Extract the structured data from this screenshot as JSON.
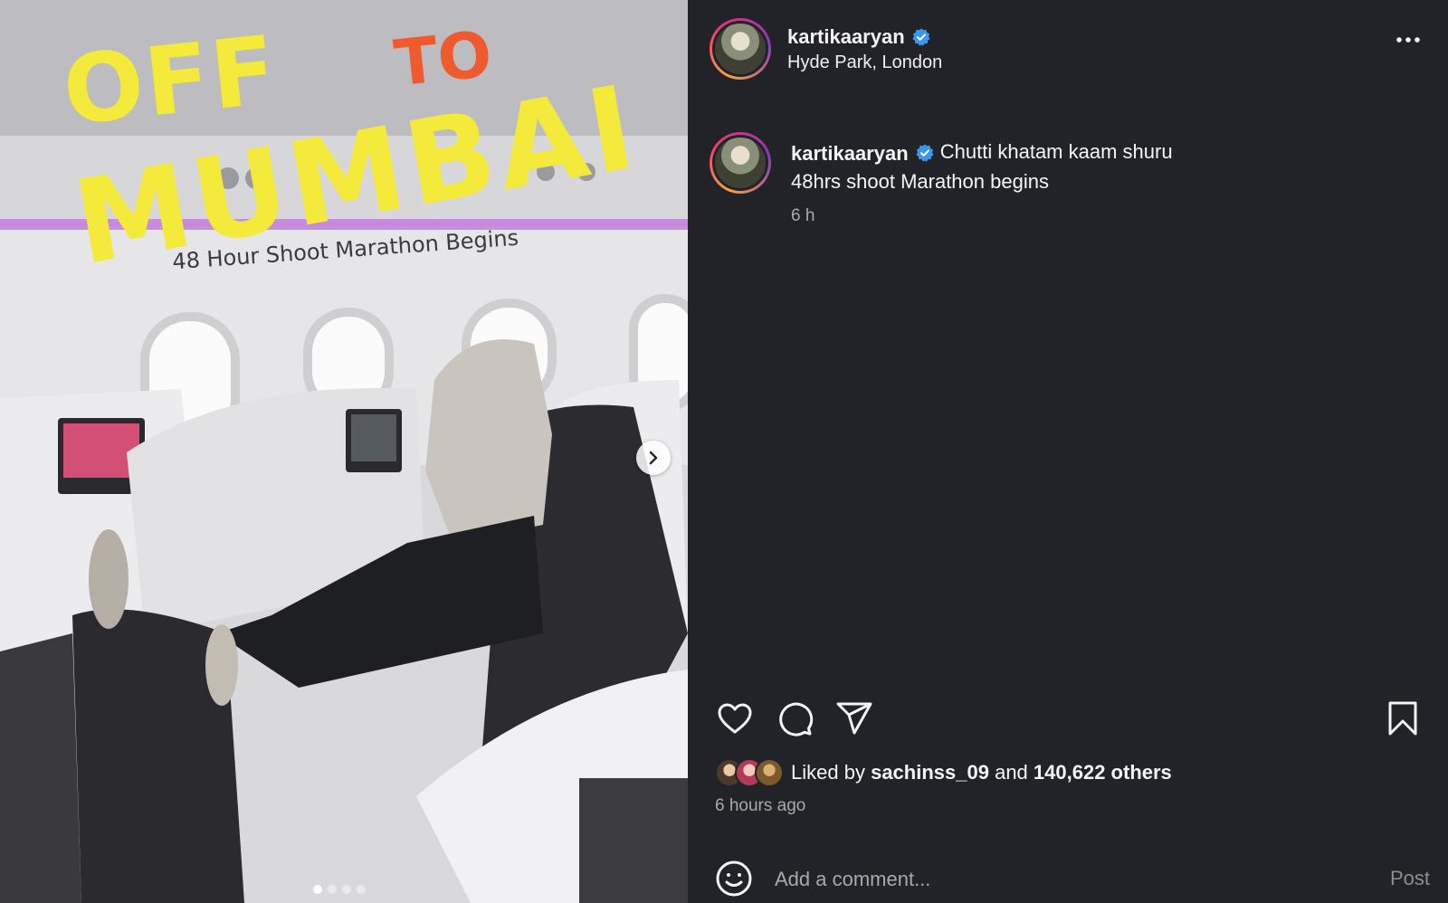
{
  "media": {
    "overlay_line1": "OFF",
    "overlay_line2": "TO",
    "overlay_line3": "MUMBAI",
    "overlay_subtitle": "48 Hour Shoot Marathon Begins",
    "slide_count": 4,
    "active_slide": 1,
    "next_icon": "chevron-right-icon"
  },
  "post": {
    "username": "kartikaaryan",
    "location": "Hyde Park, London",
    "verified_icon": "verified-badge-icon",
    "more_icon": "more-horizontal-icon",
    "caption_line1": "Chutti khatam kaam shuru",
    "caption_line2": "48hrs shoot Marathon begins",
    "caption_time": "6 h"
  },
  "actions": {
    "like_icon": "heart-icon",
    "comment_icon": "comment-icon",
    "share_icon": "send-icon",
    "save_icon": "bookmark-icon"
  },
  "likes": {
    "prefix": "Liked by",
    "liked_by_user": "sachinss_09",
    "conjunction": "and",
    "others": "140,622 others",
    "time_ago": "6 hours ago"
  },
  "comment": {
    "placeholder": "Add a comment...",
    "post_label": "Post",
    "emoji_icon": "emoji-icon"
  },
  "colors": {
    "background": "#212328",
    "verified": "#3897f0",
    "overlay_yellow": "#f4ea3c",
    "overlay_orange": "#ef5a2e"
  }
}
